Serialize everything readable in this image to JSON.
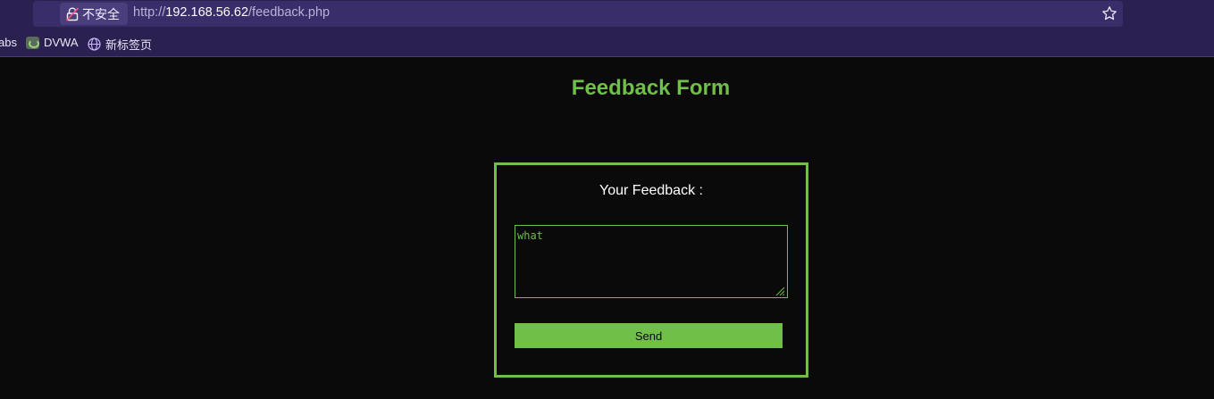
{
  "browser": {
    "security_label": "不安全",
    "url_scheme": "http://",
    "url_host": "192.168.56.62",
    "url_path": "/feedback.php",
    "bookmarks": [
      {
        "label": "abs"
      },
      {
        "label": "DVWA"
      },
      {
        "label": "新标签页"
      }
    ]
  },
  "page": {
    "title": "Feedback Form",
    "form": {
      "label": "Your Feedback :",
      "textarea_value": "what",
      "send_label": "Send"
    }
  },
  "colors": {
    "accent": "#6fbf48",
    "background": "#0a0a0a",
    "chrome": "#2b2150"
  }
}
